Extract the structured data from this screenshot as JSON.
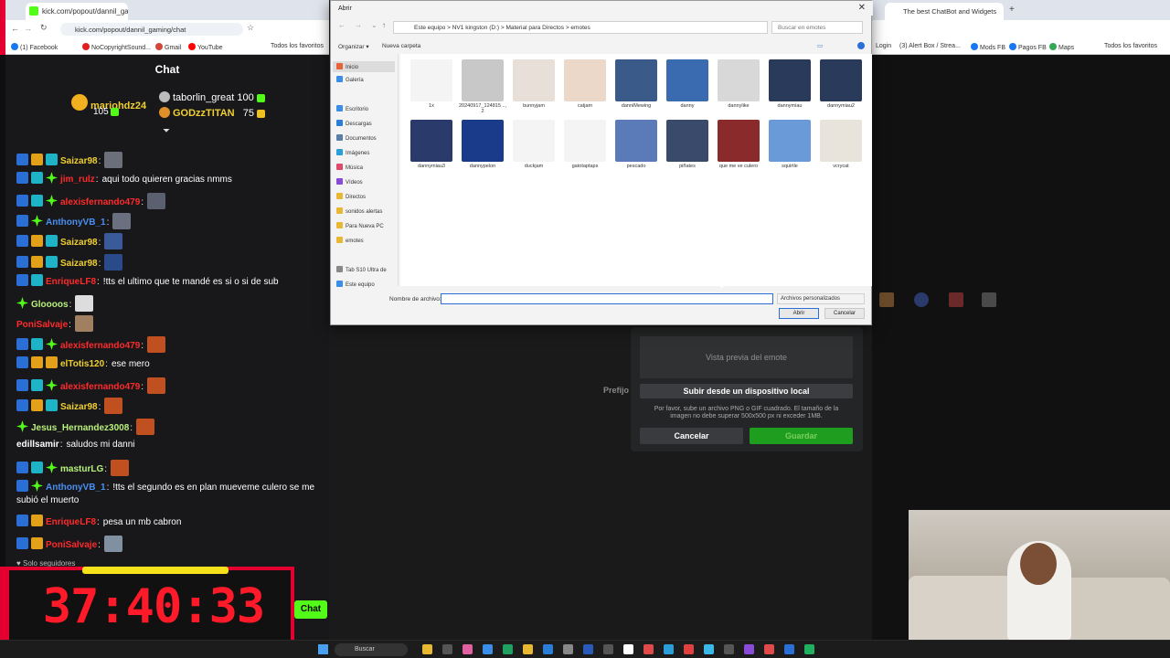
{
  "left_browser": {
    "tab_title": "kick.com/popout/dannil_gaming/chat",
    "url": "kick.com/popout/dannil_gaming/chat",
    "bookmarks": [
      "(1) Facebook",
      "NoCopyrightSound...",
      "Gmail",
      "YouTube"
    ],
    "all_favorites": "Todos los favoritos"
  },
  "chat": {
    "title": "Chat",
    "top_gifters": [
      {
        "name": "mariohdz24",
        "count": "105"
      },
      {
        "name": "taborlin_great",
        "count": "100"
      },
      {
        "name": "GODzzTITAN",
        "count": "75"
      }
    ],
    "messages": [
      {
        "user": "Saizar98",
        "text": "",
        "color": "u-y",
        "badges": [
          "b-blue",
          "b-orange",
          "b-cyan"
        ],
        "emote": "#6a6f7a"
      },
      {
        "user": "jim_rulz",
        "text": "aqui todo quieren gracias nmms",
        "color": "u-r",
        "badges": [
          "b-blue",
          "b-cyan",
          "b-green"
        ],
        "emote": ""
      },
      {
        "user": "alexisfernando479",
        "text": "",
        "color": "u-r",
        "badges": [
          "b-blue",
          "b-cyan",
          "b-green"
        ],
        "emote": "#5a6070"
      },
      {
        "user": "AnthonyVB_1",
        "text": "",
        "color": "u-b",
        "badges": [
          "b-blue",
          "b-green"
        ],
        "emote": "#6a7080"
      },
      {
        "user": "Saizar98",
        "text": "",
        "color": "u-y",
        "badges": [
          "b-blue",
          "b-orange",
          "b-cyan"
        ],
        "emote": "#3a5a9a"
      },
      {
        "user": "Saizar98",
        "text": "",
        "color": "u-y",
        "badges": [
          "b-blue",
          "b-orange",
          "b-cyan"
        ],
        "emote": "#2a4a8a"
      },
      {
        "user": "EnriqueLF8",
        "text": "!tts el ultimo que te mandé es si o si de sub",
        "color": "u-r",
        "badges": [
          "b-blue",
          "b-cyan"
        ],
        "emote": ""
      },
      {
        "user": "Gloooos",
        "text": "",
        "color": "u-g",
        "badges": [
          "b-green"
        ],
        "emote": "#dddddd"
      },
      {
        "user": "PoniSalvaje",
        "text": "",
        "color": "u-r",
        "badges": [],
        "emote": "#a08060"
      },
      {
        "user": "alexisfernando479",
        "text": "",
        "color": "u-r",
        "badges": [
          "b-blue",
          "b-cyan",
          "b-green"
        ],
        "emote": "#c05020"
      },
      {
        "user": "elTotis120",
        "text": "ese mero",
        "color": "u-y",
        "badges": [
          "b-blue",
          "b-orange",
          "b-orange"
        ],
        "emote": ""
      },
      {
        "user": "alexisfernando479",
        "text": "",
        "color": "u-r",
        "badges": [
          "b-blue",
          "b-cyan",
          "b-green"
        ],
        "emote": "#c05020"
      },
      {
        "user": "Saizar98",
        "text": "",
        "color": "u-y",
        "badges": [
          "b-blue",
          "b-orange",
          "b-cyan"
        ],
        "emote": "#c05020"
      },
      {
        "user": "Jesus_Hernandez3008",
        "text": "",
        "color": "u-g",
        "badges": [
          "b-green"
        ],
        "emote": "#c05020"
      },
      {
        "user": "edillsamir",
        "text": "saludos mi danni",
        "color": "u-w",
        "badges": [],
        "emote": ""
      },
      {
        "user": "masturLG",
        "text": "",
        "color": "u-g",
        "badges": [
          "b-blue",
          "b-cyan",
          "b-green"
        ],
        "emote": "#c05020"
      },
      {
        "user": "AnthonyVB_1",
        "text": "!tts el segundo es en plan mueveme culero se me subió el muerto",
        "color": "u-b",
        "badges": [
          "b-blue",
          "b-green"
        ],
        "emote": ""
      },
      {
        "user": "EnriqueLF8",
        "text": "pesa un mb cabron",
        "color": "u-r",
        "badges": [
          "b-blue",
          "b-orange"
        ],
        "emote": ""
      },
      {
        "user": "PoniSalvaje",
        "text": "",
        "color": "u-r",
        "badges": [
          "b-blue",
          "b-orange"
        ],
        "emote": "#8090a0"
      }
    ],
    "followers_only": "Solo seguidores",
    "send_button": "Chat"
  },
  "timer": {
    "value": "37:40:33"
  },
  "right_browser": {
    "tab_title": "The best ChatBot and Widgets",
    "bookmarks": [
      "Login",
      "(3) Alert Box / Strea...",
      "Mods FB",
      "Pagos FB",
      "Maps"
    ],
    "all_favorites": "Todos los favoritos"
  },
  "emote_upload": {
    "preview_label": "Vista previa del emote",
    "upload_button": "Subir desde un dispositivo local",
    "note": "Por favor, sube un archivo PNG o GIF cuadrado. El tamaño de la imagen no debe superar 500x500 px ni exceder 1MB.",
    "cancel": "Cancelar",
    "save": "Guardar",
    "prefix_label": "Prefijo"
  },
  "file_dialog": {
    "title": "Abrir",
    "breadcrumb": "Este equipo  >  NV1 kingston (D:)  >  Material para Directos  >  emotes",
    "search_placeholder": "Buscar en emotes",
    "organize": "Organizar",
    "new_folder": "Nueva carpeta",
    "sidebar": [
      {
        "label": "Inicio",
        "color": "#e8623a"
      },
      {
        "label": "Galería",
        "color": "#3a8ee8"
      },
      {
        "label": "Escritorio",
        "color": "#3a8ee8"
      },
      {
        "label": "Descargas",
        "color": "#2a7ed8"
      },
      {
        "label": "Documentos",
        "color": "#5a7ea8"
      },
      {
        "label": "Imágenes",
        "color": "#2a9ed8"
      },
      {
        "label": "Música",
        "color": "#e04a6a"
      },
      {
        "label": "Vídeos",
        "color": "#8a4ad8"
      },
      {
        "label": "Directos",
        "color": "#e8b830"
      },
      {
        "label": "sonidos alertas",
        "color": "#e8b830"
      },
      {
        "label": "Para Nueva PC",
        "color": "#e8b830"
      },
      {
        "label": "emotes",
        "color": "#e8b830"
      },
      {
        "label": "Tab S10 Ultra de",
        "color": "#888888"
      },
      {
        "label": "Este equipo",
        "color": "#3a8ee8"
      }
    ],
    "files": [
      {
        "name": "1x",
        "color": "#f4f4f4"
      },
      {
        "name": "20240917_124815 .., 2",
        "color": "#c8c8c8"
      },
      {
        "name": "bunnyjam",
        "color": "#e8e0d8"
      },
      {
        "name": "catjam",
        "color": "#ecd8c8"
      },
      {
        "name": "danniMewing",
        "color": "#3a5a8a"
      },
      {
        "name": "danny",
        "color": "#3a6ab0"
      },
      {
        "name": "dannylike",
        "color": "#d8d8d8"
      },
      {
        "name": "dannymiau",
        "color": "#2a3a5a"
      },
      {
        "name": "dannymiau2",
        "color": "#2a3a5a"
      },
      {
        "name": "dannymiau3",
        "color": "#2a3a6a"
      },
      {
        "name": "dannypelon",
        "color": "#1a3a8a"
      },
      {
        "name": "duckjam",
        "color": "#f4f4f4"
      },
      {
        "name": "gatotaptaps",
        "color": "#f4f4f4"
      },
      {
        "name": "pescado",
        "color": "#5a7ab8"
      },
      {
        "name": "piñates",
        "color": "#3a4a6a"
      },
      {
        "name": "que me ve culero",
        "color": "#8a2a2a"
      },
      {
        "name": "squirtle",
        "color": "#6a9ad8"
      },
      {
        "name": "vcrycat",
        "color": "#e8e4dc"
      }
    ],
    "filename_label": "Nombre de archivo:",
    "filename_value": "",
    "file_type": "Archivos personalizados",
    "open": "Abrir",
    "cancel": "Cancelar"
  },
  "taskbar": {
    "search": "Buscar"
  }
}
